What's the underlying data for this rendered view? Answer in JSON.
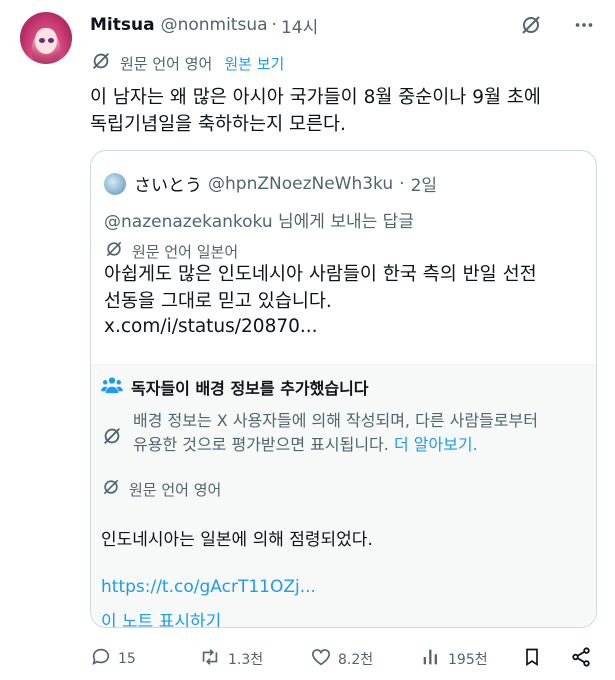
{
  "author": {
    "name": "Mitsua",
    "handle": "@nonmitsua",
    "separator": "·",
    "time": "14시"
  },
  "translation": {
    "label": "원문 언어 영어",
    "show_original": "원본 보기"
  },
  "tweet": {
    "text": "이 남자는 왜 많은 아시아 국가들이 8월 중순이나 9월 초에\n독립기념일을 축하하는지 모른다."
  },
  "quote": {
    "name": "さいとう",
    "handle": "@hpnZNoezNeWh3ku",
    "separator": "·",
    "time": "2일",
    "reply_to": "@nazenazekankoku 님에게 보내는 답글",
    "translation_label": "원문 언어 일본어",
    "text": "아쉽게도 많은 인도네시아 사람들이 한국 측의 반일 선전\n선동을 그대로 믿고 있습니다.",
    "link": "x.com/i/status/20870..."
  },
  "community_note": {
    "title": "독자들이 배경 정보를 추가했습니다",
    "info": "배경 정보는 X 사용자들에 의해 작성되며, 다른 사람들로부터\n유용한 것으로 평가받으면 표시됩니다.",
    "learn_more": "더 알아보기.",
    "translation_label": "원문 언어 영어",
    "body": "인도네시아는 일본에 의해 점령되었다.",
    "link": "https://t.co/gAcrT11OZj...",
    "show_note": "이 노트 표시하기"
  },
  "actions": {
    "replies": "15",
    "reposts": "1.3천",
    "likes": "8.2천",
    "views": "195천"
  },
  "icons": {
    "translate": "translate-slash-icon",
    "grok": "grok-icon",
    "more": "more-icon",
    "community": "people-icon",
    "reply": "reply-icon",
    "repost": "repost-icon",
    "like": "heart-icon",
    "views": "analytics-icon",
    "bookmark": "bookmark-icon",
    "share": "share-icon"
  },
  "colors": {
    "accent": "#1d9bf0",
    "muted": "#536471",
    "text": "#0f1419",
    "note_bg": "#f7f9f9"
  }
}
